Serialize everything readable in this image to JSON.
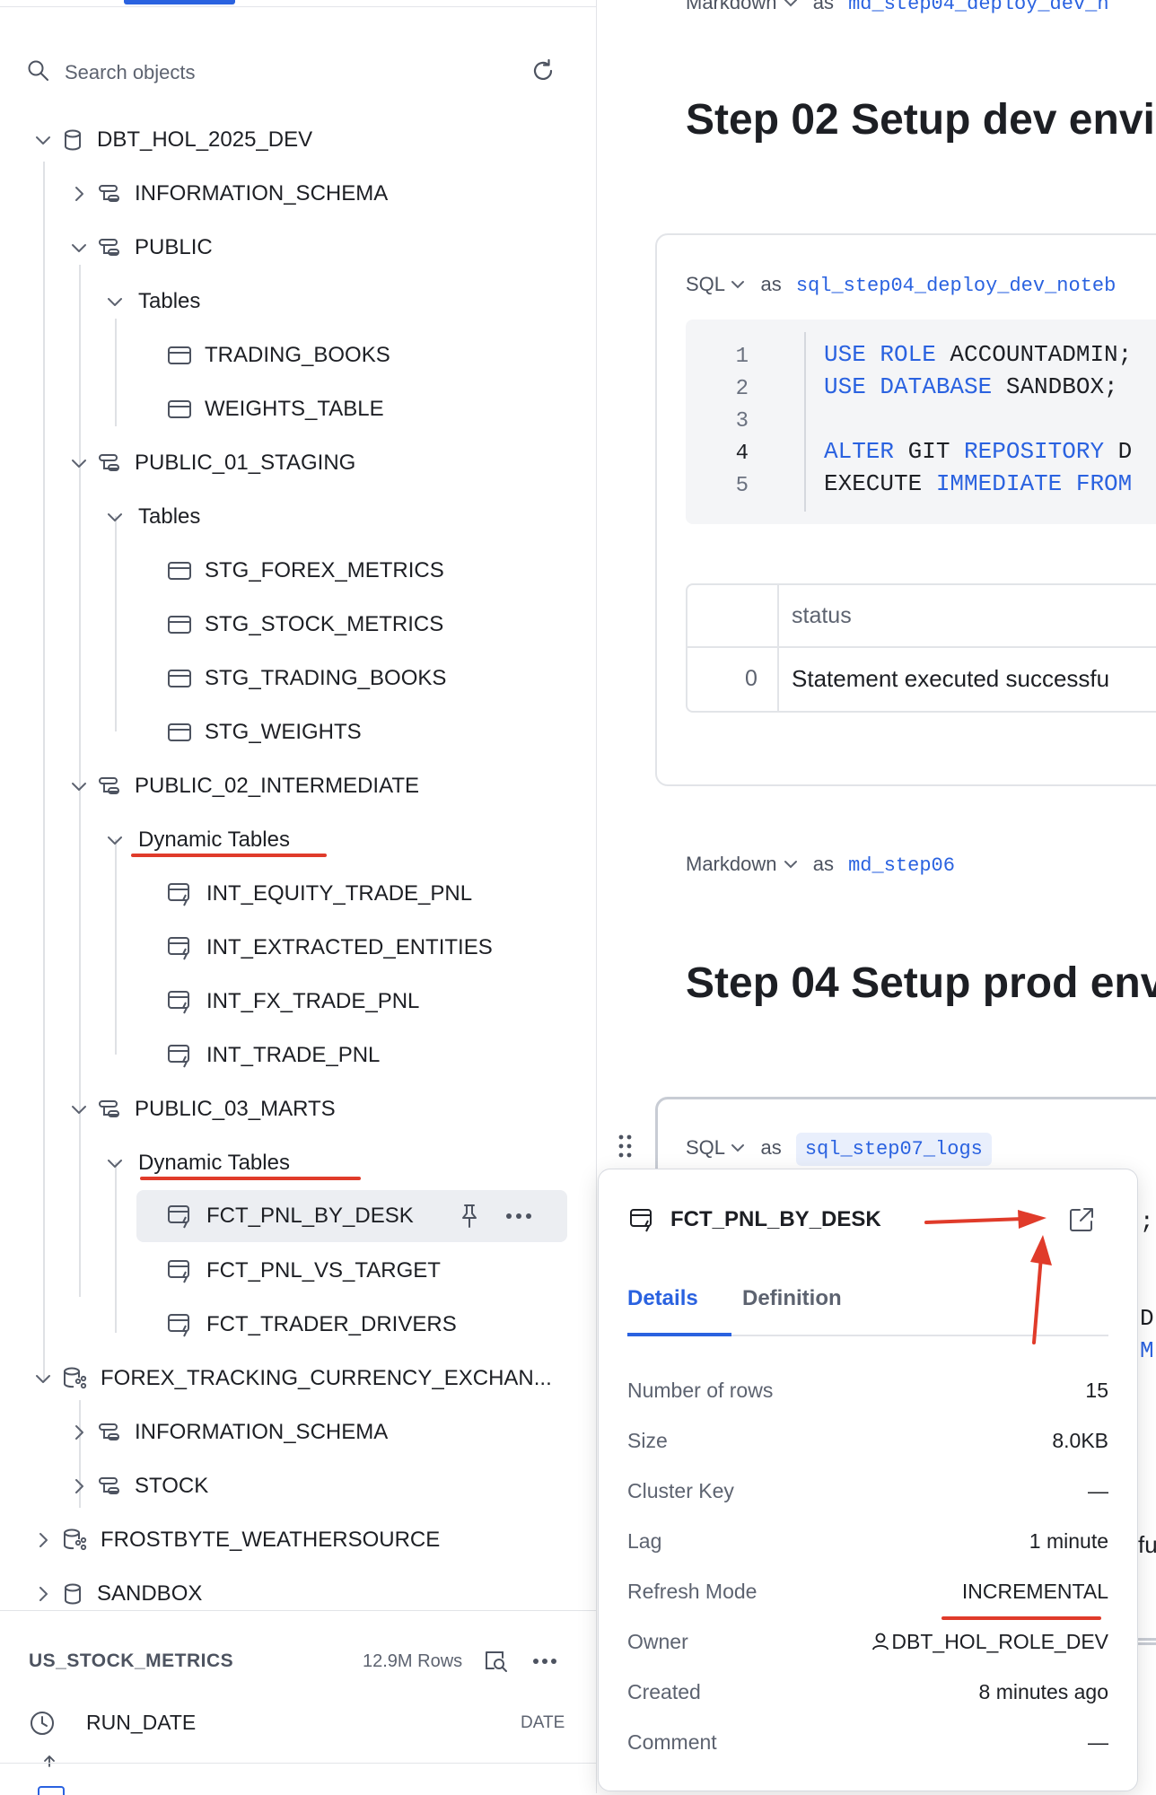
{
  "search": {
    "placeholder": "Search objects"
  },
  "tree": {
    "db1": "DBT_HOL_2025_DEV",
    "info_schema_1": "INFORMATION_SCHEMA",
    "public": "PUBLIC",
    "public_tables": "Tables",
    "trading_books": "TRADING_BOOKS",
    "weights_table": "WEIGHTS_TABLE",
    "staging": "PUBLIC_01_STAGING",
    "staging_tables": "Tables",
    "stg_forex": "STG_FOREX_METRICS",
    "stg_stock": "STG_STOCK_METRICS",
    "stg_trading_books": "STG_TRADING_BOOKS",
    "stg_weights": "STG_WEIGHTS",
    "intermediate": "PUBLIC_02_INTERMEDIATE",
    "int_dynamic": "Dynamic Tables",
    "int_equity": "INT_EQUITY_TRADE_PNL",
    "int_extracted": "INT_EXTRACTED_ENTITIES",
    "int_fx": "INT_FX_TRADE_PNL",
    "int_trade": "INT_TRADE_PNL",
    "marts": "PUBLIC_03_MARTS",
    "marts_dynamic": "Dynamic Tables",
    "fct_pnl_by_desk": "FCT_PNL_BY_DESK",
    "fct_pnl_vs_target": "FCT_PNL_VS_TARGET",
    "fct_trader_drivers": "FCT_TRADER_DRIVERS",
    "db2": "FOREX_TRACKING_CURRENCY_EXCHAN...",
    "info_schema_2": "INFORMATION_SCHEMA",
    "stock": "STOCK",
    "db3": "FROSTBYTE_WEATHERSOURCE",
    "db4": "SANDBOX"
  },
  "bottom": {
    "table_name": "US_STOCK_METRICS",
    "rows": "12.9M Rows",
    "column_name": "RUN_DATE",
    "column_type": "DATE"
  },
  "notebook": {
    "cell0_type": "Markdown",
    "cell0_as": "as",
    "cell0_name": "md_step04_deploy_dev_n",
    "heading1": "Step 02 Setup dev envi",
    "cell1_type": "SQL",
    "cell1_as": "as",
    "cell1_name": "sql_step04_deploy_dev_noteb",
    "code_lines": [
      {
        "n": "1",
        "kw1": "USE ROLE",
        "rest": " ACCOUNTADMIN;"
      },
      {
        "n": "2",
        "kw1": "USE DATABASE",
        "rest": " SANDBOX;"
      },
      {
        "n": "3",
        "kw1": "",
        "rest": ""
      },
      {
        "n": "4",
        "kw1": "ALTER",
        "rest": " GIT ",
        "kw2": "REPOSITORY",
        "rest2": " D"
      },
      {
        "n": "5",
        "kw1": "",
        "rest": "EXECUTE ",
        "kw2": "IMMEDIATE FROM",
        "rest2": ""
      }
    ],
    "result_header": "status",
    "result_index": "0",
    "result_value": "Statement executed successfu",
    "cell2_type": "Markdown",
    "cell2_as": "as",
    "cell2_name": "md_step06",
    "heading2": "Step 04 Setup prod env",
    "cell3_type": "SQL",
    "cell3_as": "as",
    "cell3_name": "sql_step07_logs",
    "peek1": ";",
    "peek2": "D",
    "peek3": "M",
    "peek4": "fu"
  },
  "popover": {
    "title": "FCT_PNL_BY_DESK",
    "tab_details": "Details",
    "tab_definition": "Definition",
    "rows": [
      {
        "k": "Number of rows",
        "v": "15"
      },
      {
        "k": "Size",
        "v": "8.0KB"
      },
      {
        "k": "Cluster Key",
        "v": "—"
      },
      {
        "k": "Lag",
        "v": "1 minute"
      },
      {
        "k": "Refresh Mode",
        "v": "INCREMENTAL"
      },
      {
        "k": "Owner",
        "v": "DBT_HOL_ROLE_DEV"
      },
      {
        "k": "Created",
        "v": "8 minutes ago"
      },
      {
        "k": "Comment",
        "v": "—"
      }
    ]
  },
  "colors": {
    "accent": "#2a62e0",
    "annotation": "#e03b2a",
    "selected_bg": "#eceef2"
  }
}
